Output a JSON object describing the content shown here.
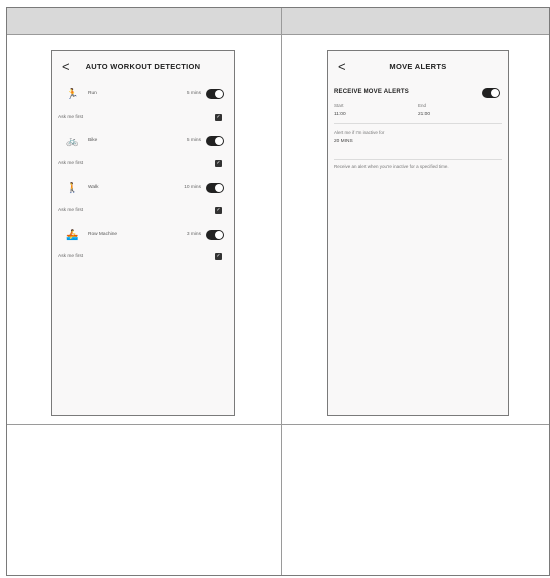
{
  "left_screen": {
    "title": "AUTO WORKOUT DETECTION",
    "back_glyph": "<",
    "ask_label": "Ask me first",
    "activities": [
      {
        "icon": "run-icon",
        "glyph": "🏃",
        "label": "Run",
        "minutes": "5 mins"
      },
      {
        "icon": "bike-icon",
        "glyph": "🚲",
        "label": "Bike",
        "minutes": "5 mins"
      },
      {
        "icon": "walk-icon",
        "glyph": "🚶",
        "label": "Walk",
        "minutes": "10 mins"
      },
      {
        "icon": "row-machine-icon",
        "glyph": "🚣",
        "label": "Row Machine",
        "minutes": "3 mins"
      }
    ]
  },
  "right_screen": {
    "title": "MOVE ALERTS",
    "back_glyph": "<",
    "receive_label": "RECEIVE MOVE ALERTS",
    "start_label": "Start",
    "start_value": "11:00",
    "end_label": "End",
    "end_value": "21:00",
    "inactive_label": "Alert me if I'm inactive for",
    "inactive_value": "20 MINS",
    "description": "Receive an alert when you're inactive for a specified time."
  },
  "colors": {
    "toggle_on": "#222222",
    "header_bg": "#d9d9d9",
    "phone_bg": "#f9f8f8"
  }
}
